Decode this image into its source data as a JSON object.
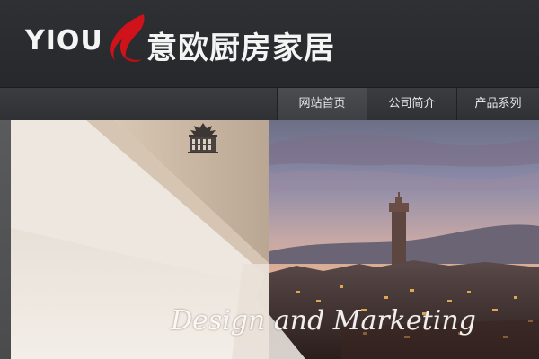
{
  "brand": {
    "logo_text": "YIOU",
    "name": "意欧厨房家居",
    "accent_color": "#d0121b"
  },
  "nav": {
    "items": [
      {
        "label": "网站首页",
        "active": true
      },
      {
        "label": "公司简介",
        "active": false
      },
      {
        "label": "产品系列",
        "active": false
      }
    ]
  },
  "banner": {
    "slogan": "Design and Marketing",
    "emblem_icon": "palazzo-facade-icon",
    "scene": "city-skyline-at-dusk"
  }
}
